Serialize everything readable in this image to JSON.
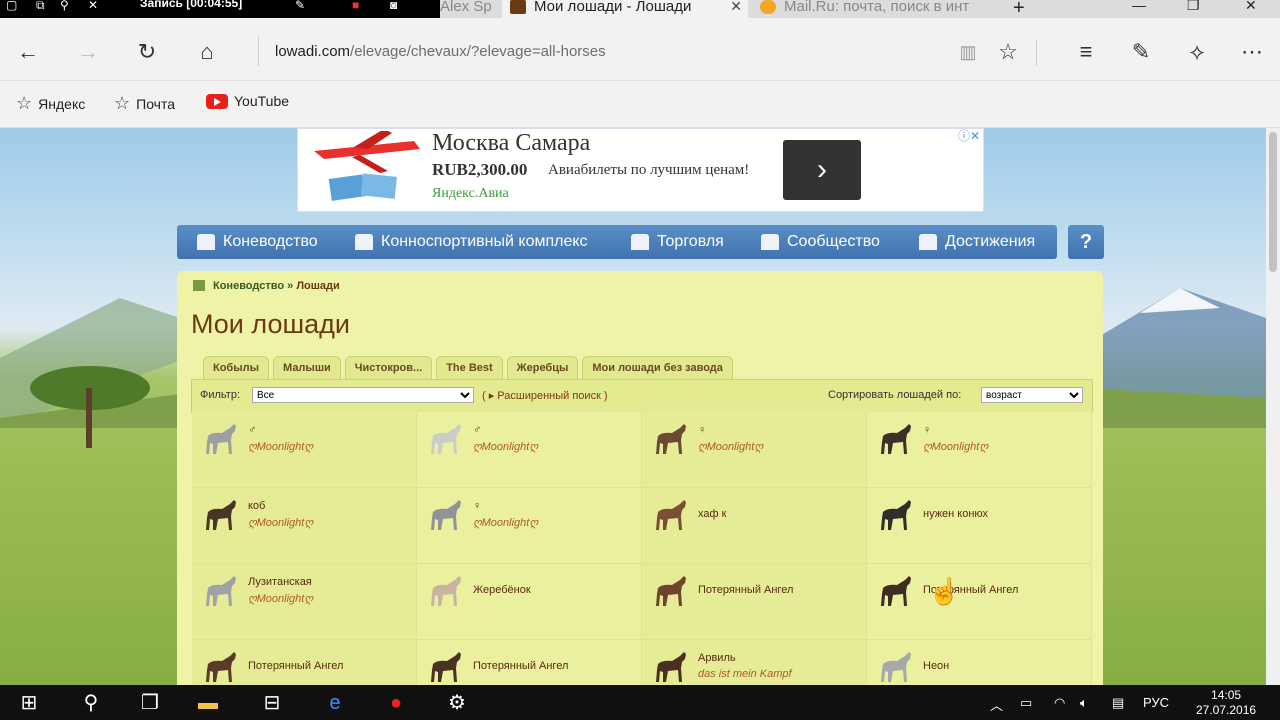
{
  "tabbar": {
    "recording_label": "Запись [00:04:55]",
    "tabs": [
      {
        "title": "Alex Sp",
        "active": false
      },
      {
        "title": "Мои лошади - Лошади",
        "active": true
      },
      {
        "title": "Mail.Ru: почта, поиск в инт",
        "active": false
      }
    ],
    "new_tab_glyph": "+",
    "window_controls": [
      "—",
      "❐",
      "✕"
    ]
  },
  "address_bar": {
    "url_host": "lowadi.com",
    "url_path": "/elevage/chevaux/?elevage=all-horses"
  },
  "favorites": [
    {
      "label": "Яндекс",
      "icon": "star-icon"
    },
    {
      "label": "Почта",
      "icon": "star-icon"
    },
    {
      "label": "YouTube",
      "icon": "youtube-icon"
    }
  ],
  "ad": {
    "title": "Москва Самара",
    "price": "RUB2,300.00",
    "description": "Авиабилеты по лучшим ценам!",
    "source": "Яндекс.Авиа",
    "button_glyph": "›"
  },
  "menu": {
    "items": [
      {
        "label": "Коневодство"
      },
      {
        "label": "Конноспортивный комплекс"
      },
      {
        "label": "Торговля"
      },
      {
        "label": "Сообщество"
      },
      {
        "label": "Достижения"
      }
    ],
    "help_label": "?"
  },
  "page": {
    "breadcrumb_root": "Коневодство",
    "breadcrumb_sep": "»",
    "breadcrumb_current": "Лошади",
    "title": "Мои лошади",
    "tabs": [
      "Кобылы",
      "Малыши",
      "Чистокров...",
      "The Best",
      "Жеребцы",
      "Мои лошади без завода"
    ],
    "filter_label": "Фильтр:",
    "filter_value": "Все",
    "advanced_search": "( ▸ Расширенный поиск )",
    "sort_label": "Сортировать лошадей по:",
    "sort_value": "возраст"
  },
  "horses": [
    {
      "name": "♂",
      "owner": "ღMoonlightღ",
      "color": "#9a9fa2"
    },
    {
      "name": "♂",
      "owner": "ღMoonlightღ",
      "color": "#c9ccc9"
    },
    {
      "name": "♀",
      "owner": "ღMoonlightღ",
      "color": "#6a4a32"
    },
    {
      "name": "♀",
      "owner": "ღMoonlightღ",
      "color": "#3e3026"
    },
    {
      "name": "коб",
      "owner": "ღMoonlightღ",
      "color": "#4a3424"
    },
    {
      "name": "♀",
      "owner": "ღMoonlightღ",
      "color": "#8f9496"
    },
    {
      "name": "хаф к",
      "owner": "",
      "color": "#7a5034"
    },
    {
      "name": "нужен конюх",
      "owner": "",
      "color": "#2e2e2a"
    },
    {
      "name": "Лузитанская",
      "owner": "ღMoonlightღ",
      "color": "#a0a3a5"
    },
    {
      "name": "Жеребёнок",
      "owner": "",
      "color": "#c8b4a0"
    },
    {
      "name": "Потерянный Ангел",
      "owner": "",
      "color": "#6e442c"
    },
    {
      "name": "Потерянный Ангел",
      "owner": "",
      "color": "#3e2e22"
    },
    {
      "name": "Потерянный Ангел",
      "owner": "",
      "color": "#5a3a28"
    },
    {
      "name": "Потерянный Ангел",
      "owner": "",
      "color": "#4a3222"
    },
    {
      "name": "Арвиль",
      "owner": "das ist mein Kampf",
      "color": "#4a3020"
    },
    {
      "name": "Неон",
      "owner": "",
      "color": "#a6a8aa"
    }
  ],
  "taskbar": {
    "language": "РУС",
    "time": "14:05",
    "date": "27.07.2016"
  }
}
